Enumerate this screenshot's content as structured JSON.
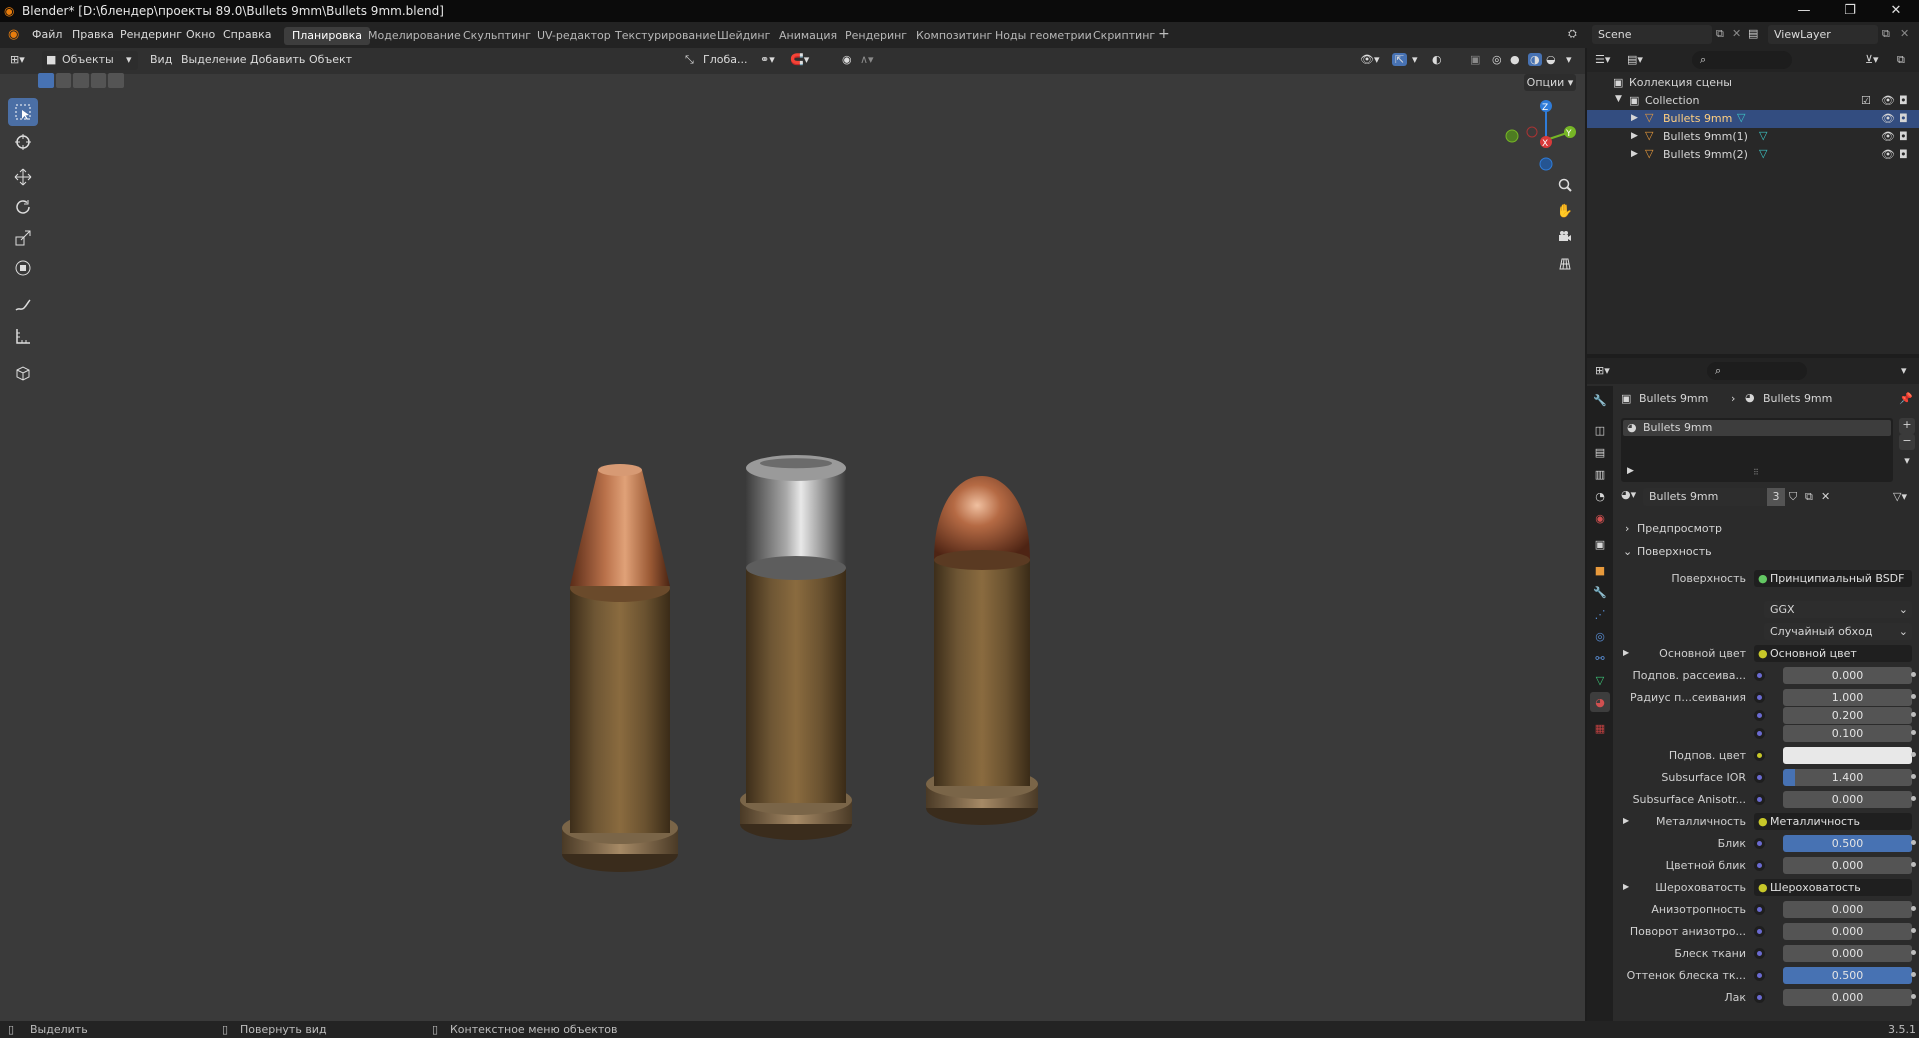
{
  "window": {
    "title": "Blender* [D:\\блендер\\проекты 89.0\\Bullets 9mm\\Bullets 9mm.blend]"
  },
  "menubar": {
    "menus": [
      "Файл",
      "Правка",
      "Рендеринг",
      "Окно",
      "Справка"
    ],
    "workspaces": [
      "Планировка",
      "Моделирование",
      "Скульптинг",
      "UV-редактор",
      "Текстурирование",
      "Шейдинг",
      "Анимация",
      "Рендеринг",
      "Композитинг",
      "Ноды геометрии",
      "Скриптинг"
    ],
    "active_workspace": "Планировка",
    "scene": "Scene",
    "viewlayer": "ViewLayer"
  },
  "viewport": {
    "mode": "Объекты",
    "menus": [
      "Вид",
      "Выделение",
      "Добавить",
      "Объект"
    ],
    "orientation": "Глоба...",
    "options": "Опции",
    "gizmo_axes": {
      "x": "X",
      "y": "Y",
      "z": "Z"
    }
  },
  "outliner": {
    "root": "Коллекция сцены",
    "collection": "Collection",
    "objects": [
      "Bullets 9mm",
      "Bullets 9mm(1)",
      "Bullets 9mm(2)"
    ],
    "selected": "Bullets 9mm"
  },
  "properties": {
    "breadcrumb_object": "Bullets 9mm",
    "breadcrumb_material": "Bullets 9mm",
    "slot": "Bullets 9mm",
    "material_name": "Bullets 9mm",
    "users": "3",
    "panels": {
      "preview": "Предпросмотр",
      "surface": "Поверхность"
    },
    "surface_label": "Поверхность",
    "surface_value": "Принципиальный BSDF",
    "distribution": "GGX",
    "sss_method": "Случайный обход",
    "rows": [
      {
        "label": "Основной цвет",
        "value": "Основной цвет",
        "kind": "link"
      },
      {
        "label": "Подпов. рассеива...",
        "value": "0.000",
        "kind": "num"
      },
      {
        "label": "Радиус п...сеивания",
        "value": "1.000",
        "kind": "num"
      },
      {
        "label": "",
        "value": "0.200",
        "kind": "num"
      },
      {
        "label": "",
        "value": "0.100",
        "kind": "num"
      },
      {
        "label": "Подпов. цвет",
        "value": "",
        "kind": "color"
      },
      {
        "label": "Subsurface IOR",
        "value": "1.400",
        "kind": "num"
      },
      {
        "label": "Subsurface Anisotr...",
        "value": "0.000",
        "kind": "num"
      },
      {
        "label": "Металличность",
        "value": "Металличность",
        "kind": "link"
      },
      {
        "label": "Блик",
        "value": "0.500",
        "kind": "blue"
      },
      {
        "label": "Цветной блик",
        "value": "0.000",
        "kind": "num"
      },
      {
        "label": "Шероховатость",
        "value": "Шероховатость",
        "kind": "link"
      },
      {
        "label": "Анизотропность",
        "value": "0.000",
        "kind": "num"
      },
      {
        "label": "Поворот анизотро...",
        "value": "0.000",
        "kind": "num"
      },
      {
        "label": "Блеск ткани",
        "value": "0.000",
        "kind": "num"
      },
      {
        "label": "Оттенок блеска тк...",
        "value": "0.500",
        "kind": "blue"
      },
      {
        "label": "Лак",
        "value": "0.000",
        "kind": "num"
      }
    ]
  },
  "statusbar": {
    "select": "Выделить",
    "rotate": "Повернуть вид",
    "context": "Контекстное меню объектов",
    "version": "3.5.1"
  },
  "colors": {
    "accent": "#4772b3",
    "selected_row": "#334d80",
    "viewport_bg": "#3a3a3a"
  }
}
